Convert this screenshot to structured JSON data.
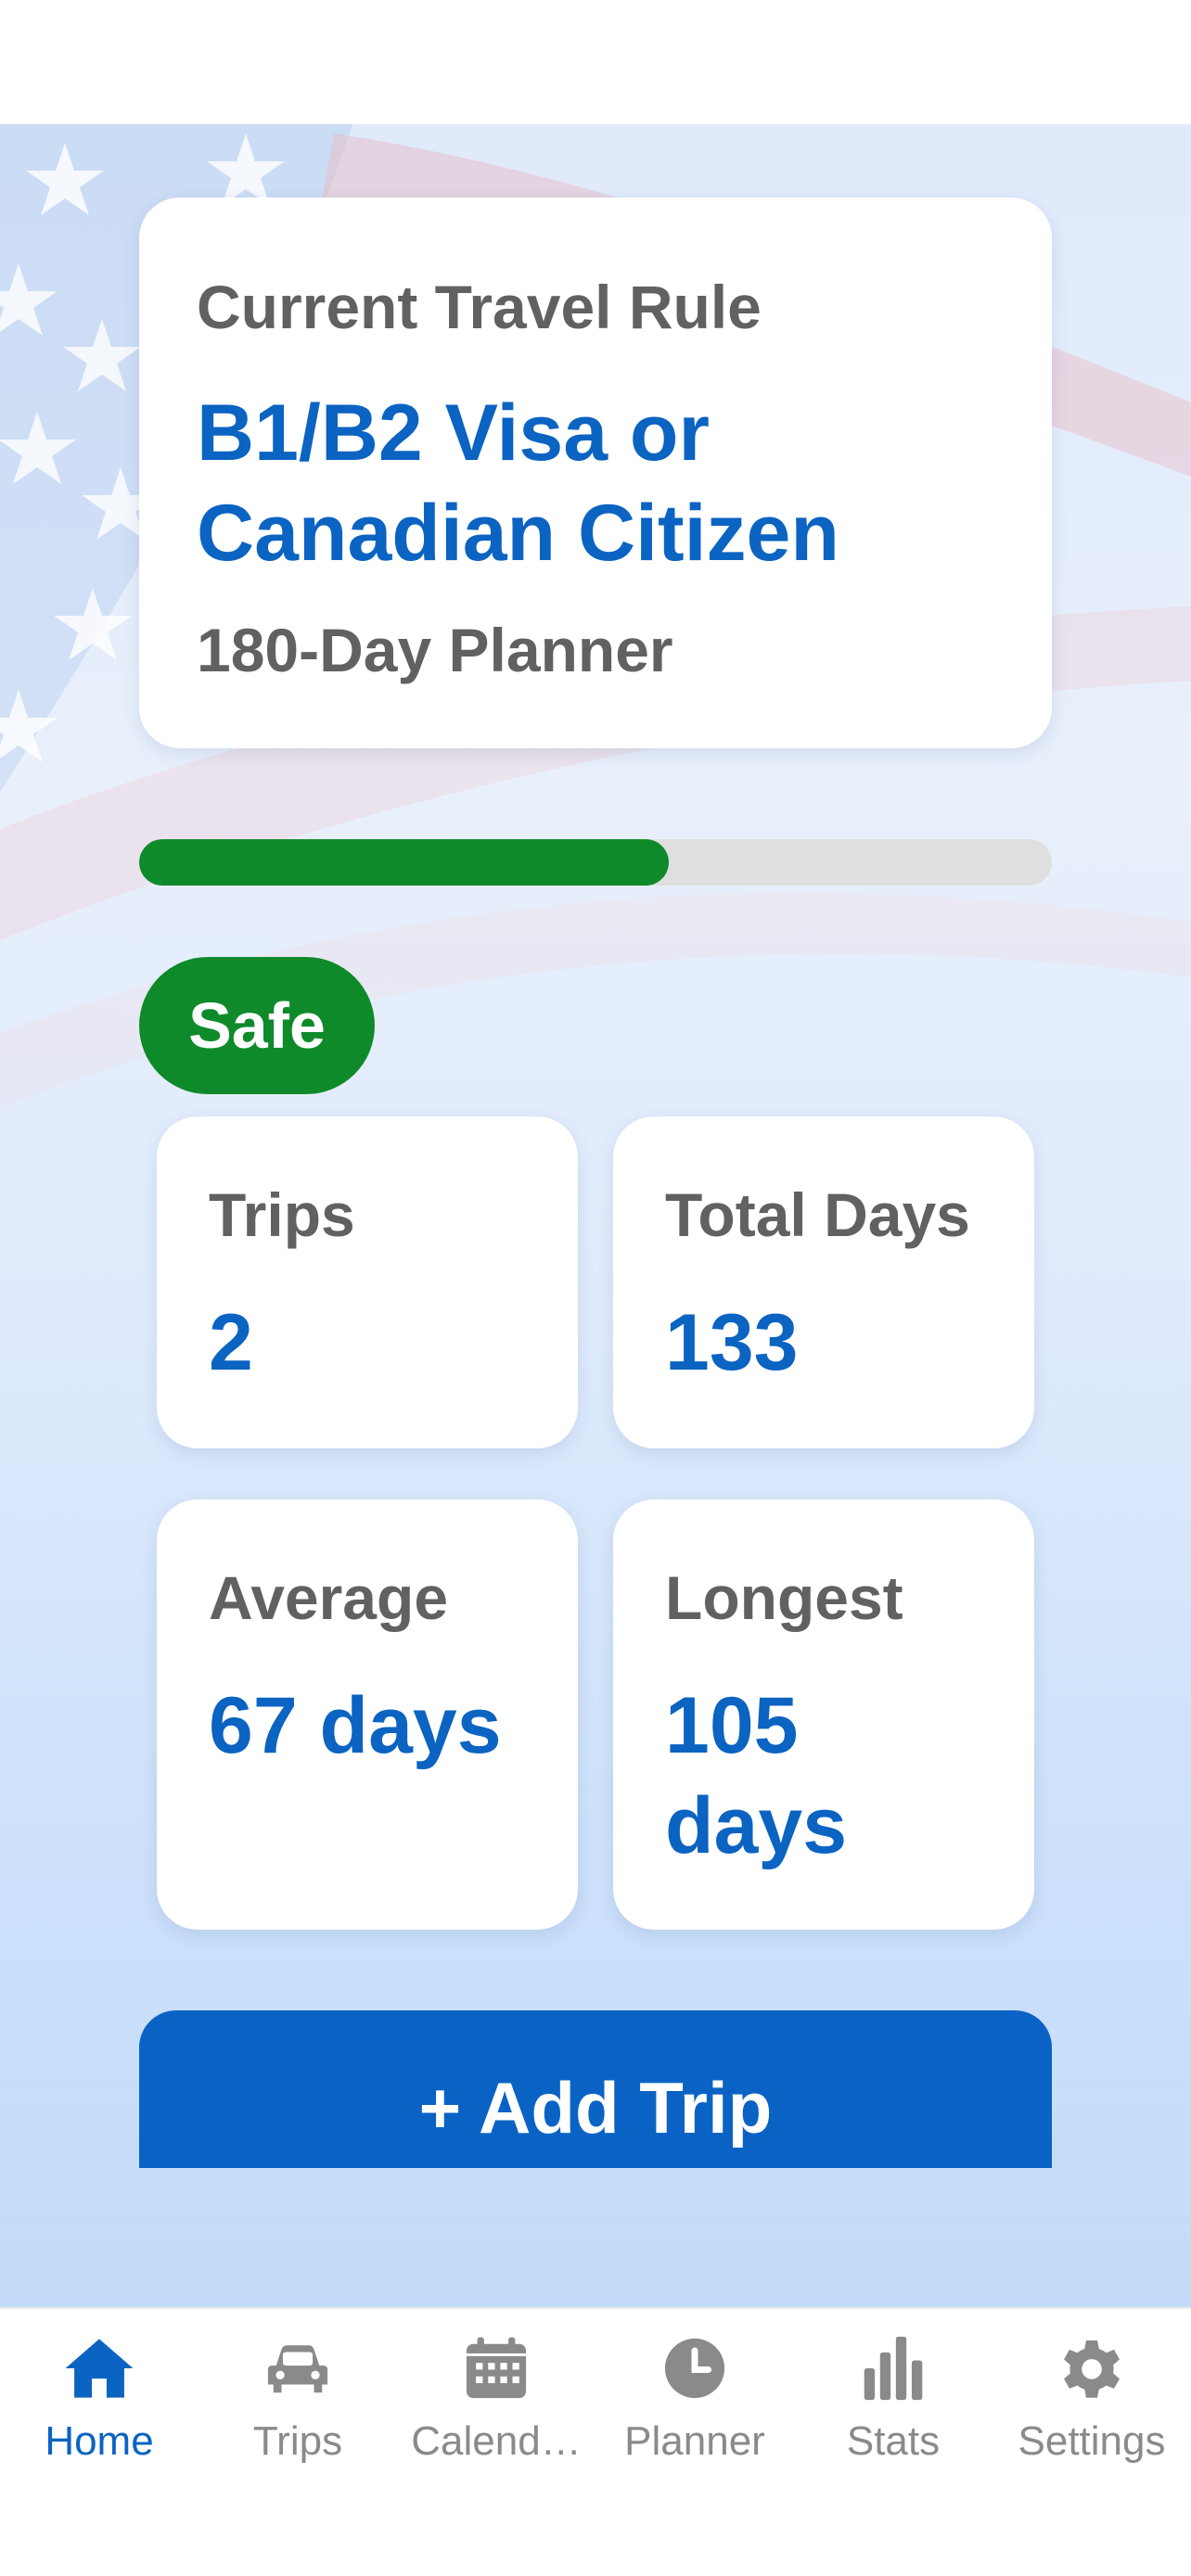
{
  "rule_card": {
    "label": "Current Travel Rule",
    "title": "B1/B2 Visa or Canadian Citizen",
    "subtitle": "180-Day Planner"
  },
  "progress": {
    "fraction": 0.58,
    "color": "#0f8a2a"
  },
  "status_badge": {
    "label": "Safe",
    "color": "#0f8a2a"
  },
  "stats": {
    "trips": {
      "label": "Trips",
      "value": "2"
    },
    "total": {
      "label": "Total Days",
      "value": "133"
    },
    "average": {
      "label": "Average",
      "value": "67 days"
    },
    "longest": {
      "label": "Longest",
      "value": "105 days"
    }
  },
  "add_trip_button": {
    "label": "+ Add Trip"
  },
  "tabs": [
    {
      "label": "Home",
      "icon": "home-icon",
      "active": true
    },
    {
      "label": "Trips",
      "icon": "car-icon",
      "active": false
    },
    {
      "label": "Calend…",
      "icon": "calendar-icon",
      "active": false
    },
    {
      "label": "Planner",
      "icon": "clock-icon",
      "active": false
    },
    {
      "label": "Stats",
      "icon": "chart-icon",
      "active": false
    },
    {
      "label": "Settings",
      "icon": "gear-icon",
      "active": false
    }
  ],
  "colors": {
    "accent": "#0b63c2",
    "safe": "#0f8a2a",
    "inactive": "#8a8a8a"
  }
}
